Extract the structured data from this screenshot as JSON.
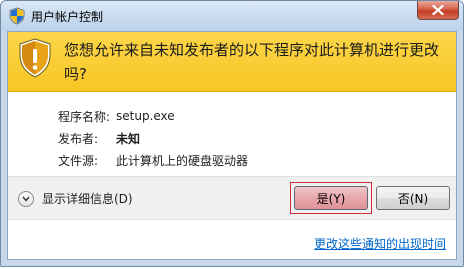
{
  "window": {
    "title": "用户帐户控制",
    "title_icon": "uac-shield-icon",
    "close_icon": "close-icon"
  },
  "banner": {
    "icon": "warning-shield-icon",
    "message": "您想允许来自未知发布者的以下程序对此计算机进行更改吗?",
    "background": "#f6c624"
  },
  "details": {
    "rows": [
      {
        "label": "程序名称:",
        "value": "setup.exe",
        "bold": false
      },
      {
        "label": "发布者:",
        "value": "未知",
        "bold": true
      },
      {
        "label": "文件源:",
        "value": "此计算机上的硬盘驱动器",
        "bold": false
      }
    ]
  },
  "footer": {
    "show_details_label": "显示详细信息(D)",
    "show_details_icon": "chevron-down-icon",
    "yes_label": "是(Y)",
    "no_label": "否(N)",
    "link_text": "更改这些通知的出现时间"
  },
  "colors": {
    "accent_highlight": "#cc2f3a",
    "link": "#0066cc"
  }
}
